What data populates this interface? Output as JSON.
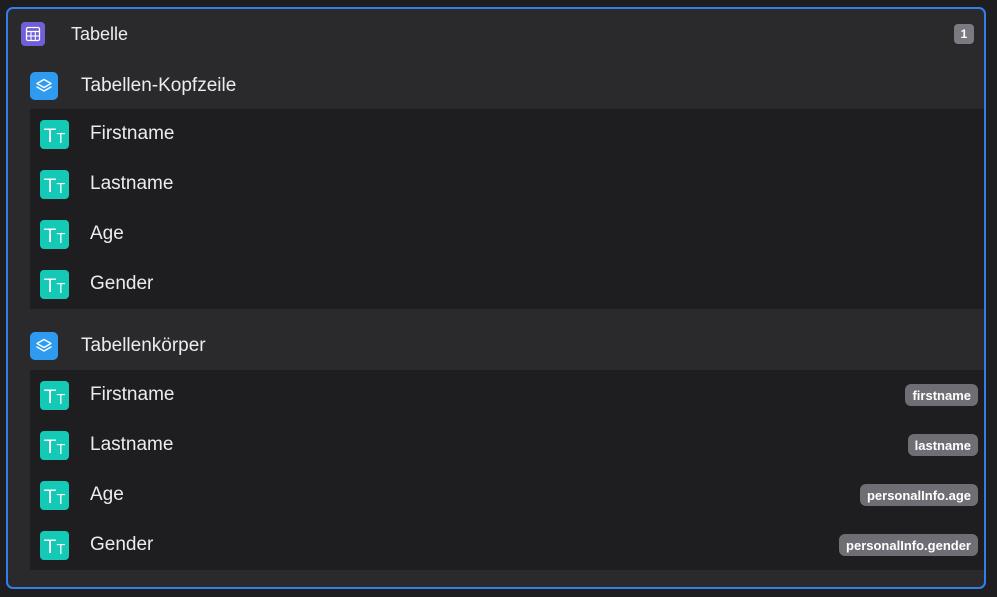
{
  "root": {
    "label": "Tabelle",
    "count": "1",
    "icon": "table-icon"
  },
  "header_group": {
    "label": "Tabellen-Kopfzeile",
    "icon": "layers-icon",
    "items": [
      {
        "label": "Firstname",
        "icon": "text-icon"
      },
      {
        "label": "Lastname",
        "icon": "text-icon"
      },
      {
        "label": "Age",
        "icon": "text-icon"
      },
      {
        "label": "Gender",
        "icon": "text-icon"
      }
    ]
  },
  "body_group": {
    "label": "Tabellenkörper",
    "icon": "layers-icon",
    "items": [
      {
        "label": "Firstname",
        "binding": "firstname",
        "icon": "text-icon"
      },
      {
        "label": "Lastname",
        "binding": "lastname",
        "icon": "text-icon"
      },
      {
        "label": "Age",
        "binding": "personalInfo.age",
        "icon": "text-icon"
      },
      {
        "label": "Gender",
        "binding": "personalInfo.gender",
        "icon": "text-icon"
      }
    ]
  },
  "colors": {
    "accent": "#2f80ed",
    "table_icon": "#6f5fd8",
    "layers_icon": "#2f9bf0",
    "text_icon": "#14c9b5"
  }
}
